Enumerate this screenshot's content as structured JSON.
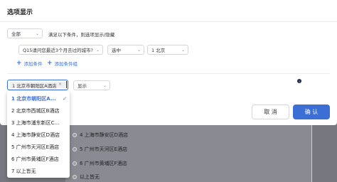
{
  "modal": {
    "title": "选项显示"
  },
  "scope_select": {
    "value": "全部"
  },
  "condition_desc": "满足以下条件，则选项显示/隐藏",
  "condition": {
    "question": "Q15请问您最近3个月去过的城市?",
    "operator": "选中",
    "answer": "1  北京"
  },
  "add_condition": "添加条件",
  "add_condition_group": "添加条件组",
  "option_tag": "1  北京市朝阳区A酒店",
  "option_tag_remove": "×",
  "action_select": {
    "value": "显示"
  },
  "info_icon": "i",
  "buttons": {
    "cancel": "取 消",
    "ok": "确 认"
  },
  "dropdown": {
    "items": [
      {
        "label": "1  北京市朝阳区A...",
        "selected": true
      },
      {
        "label": "2  北京市西城区B酒店"
      },
      {
        "label": "3  上海市浦东新区C..."
      },
      {
        "label": "4  上海市静安区D酒店"
      },
      {
        "label": "5  广州市天河区E酒店"
      },
      {
        "label": "6  广州市黄埔区F酒店"
      },
      {
        "label": "7  以上皆无"
      }
    ]
  },
  "background_list": [
    "4  上海市静安区D酒店",
    "5  广州市天河区E酒店",
    "6  广州市黄埔区F酒店",
    "以上皆无"
  ],
  "colors": {
    "accent": "#3b6fd6",
    "overlay": "#7c7c84"
  }
}
